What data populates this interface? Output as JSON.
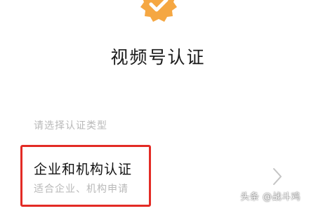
{
  "header": {
    "badge_icon": "verified-badge-icon",
    "badge_color": "#f5a742",
    "title": "视频号认证"
  },
  "selection": {
    "prompt": "请选择认证类型"
  },
  "options": [
    {
      "title": "企业和机构认证",
      "description": "适合企业、机构申请",
      "icon": "chevron-right-icon",
      "highlight_color": "#e32b25"
    }
  ],
  "watermark": {
    "text": "头条 @战斗鸡"
  }
}
